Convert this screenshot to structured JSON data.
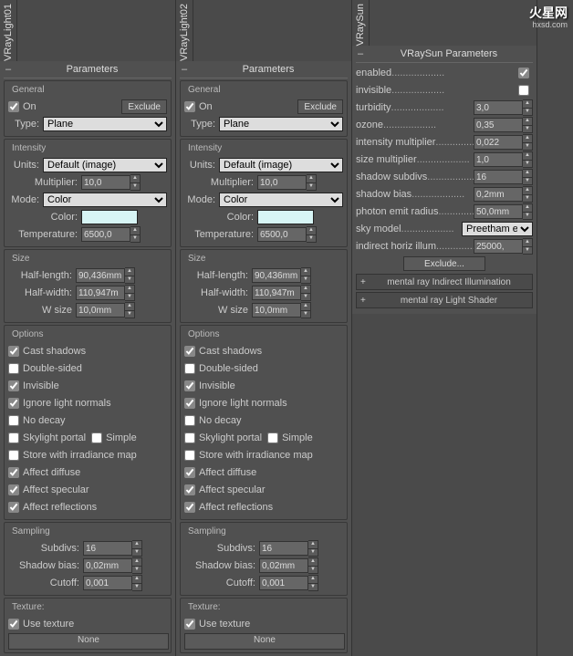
{
  "watermark": {
    "main": "火星网",
    "sub": "hxsd.com"
  },
  "tabs": [
    "VRayLight01",
    "VRayLight02",
    "VRaySun"
  ],
  "lightPanel": {
    "title": "Parameters",
    "general": {
      "label": "General",
      "on": "On",
      "exclude": "Exclude",
      "typeLabel": "Type:",
      "type": "Plane"
    },
    "intensity": {
      "label": "Intensity",
      "unitsLabel": "Units:",
      "units": "Default (image)",
      "multiplierLabel": "Multiplier:",
      "multiplier": "10,0",
      "modeLabel": "Mode:",
      "mode": "Color",
      "colorLabel": "Color:",
      "tempLabel": "Temperature:",
      "temp": "6500,0"
    },
    "size": {
      "label": "Size",
      "halfLenLabel": "Half-length:",
      "halfLen": "90,436mm",
      "halfWidLabel": "Half-width:",
      "halfWid": "110,947m",
      "wsizeLabel": "W size",
      "wsize": "10,0mm"
    },
    "options": {
      "label": "Options",
      "castShadows": "Cast shadows",
      "doubleSided": "Double-sided",
      "invisible": "Invisible",
      "ignoreNormals": "Ignore light normals",
      "noDecay": "No decay",
      "skylight": "Skylight portal",
      "simple": "Simple",
      "storeIrr": "Store with irradiance map",
      "affDiffuse": "Affect diffuse",
      "affSpec": "Affect specular",
      "affRefl": "Affect reflections"
    },
    "sampling": {
      "label": "Sampling",
      "subdivsLabel": "Subdivs:",
      "subdivs": "16",
      "shadowBiasLabel": "Shadow bias:",
      "shadowBias": "0,02mm",
      "cutoffLabel": "Cutoff:",
      "cutoff": "0,001"
    },
    "texture": {
      "label": "Texture:",
      "useTex": "Use texture",
      "none": "None"
    }
  },
  "sunPanel": {
    "title": "VRaySun Parameters",
    "rows": [
      {
        "label": "enabled",
        "type": "cb",
        "val": true
      },
      {
        "label": "invisible",
        "type": "cb",
        "val": false
      },
      {
        "label": "turbidity",
        "type": "num",
        "val": "3,0"
      },
      {
        "label": "ozone",
        "type": "num",
        "val": "0,35"
      },
      {
        "label": "intensity multiplier",
        "type": "num",
        "val": "0,022"
      },
      {
        "label": "size multiplier",
        "type": "num",
        "val": "1,0"
      },
      {
        "label": "shadow subdivs",
        "type": "num",
        "val": "16"
      },
      {
        "label": "shadow bias",
        "type": "num",
        "val": "0,2mm"
      },
      {
        "label": "photon emit radius",
        "type": "num",
        "val": "50,0mm"
      },
      {
        "label": "sky model",
        "type": "sel",
        "val": "Preetham et"
      },
      {
        "label": "indirect horiz illum",
        "type": "num",
        "val": "25000,"
      }
    ],
    "exclude": "Exclude...",
    "roll1": "mental ray Indirect Illumination",
    "roll2": "mental ray Light Shader"
  }
}
